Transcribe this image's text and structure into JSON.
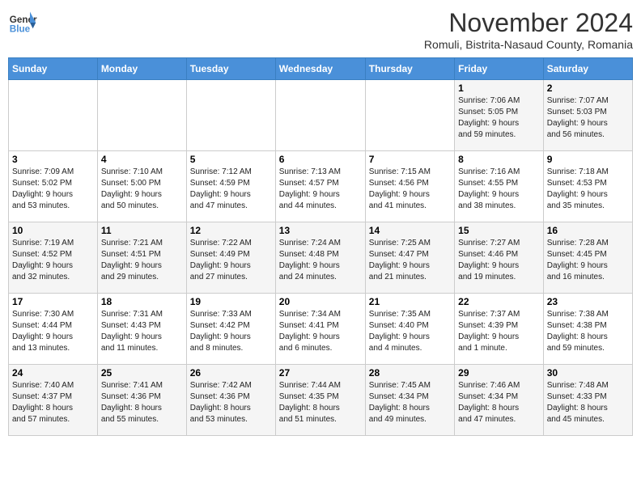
{
  "header": {
    "logo_line1": "General",
    "logo_line2": "Blue",
    "month": "November 2024",
    "location": "Romuli, Bistrita-Nasaud County, Romania"
  },
  "weekdays": [
    "Sunday",
    "Monday",
    "Tuesday",
    "Wednesday",
    "Thursday",
    "Friday",
    "Saturday"
  ],
  "weeks": [
    [
      {
        "num": "",
        "info": ""
      },
      {
        "num": "",
        "info": ""
      },
      {
        "num": "",
        "info": ""
      },
      {
        "num": "",
        "info": ""
      },
      {
        "num": "",
        "info": ""
      },
      {
        "num": "1",
        "info": "Sunrise: 7:06 AM\nSunset: 5:05 PM\nDaylight: 9 hours\nand 59 minutes."
      },
      {
        "num": "2",
        "info": "Sunrise: 7:07 AM\nSunset: 5:03 PM\nDaylight: 9 hours\nand 56 minutes."
      }
    ],
    [
      {
        "num": "3",
        "info": "Sunrise: 7:09 AM\nSunset: 5:02 PM\nDaylight: 9 hours\nand 53 minutes."
      },
      {
        "num": "4",
        "info": "Sunrise: 7:10 AM\nSunset: 5:00 PM\nDaylight: 9 hours\nand 50 minutes."
      },
      {
        "num": "5",
        "info": "Sunrise: 7:12 AM\nSunset: 4:59 PM\nDaylight: 9 hours\nand 47 minutes."
      },
      {
        "num": "6",
        "info": "Sunrise: 7:13 AM\nSunset: 4:57 PM\nDaylight: 9 hours\nand 44 minutes."
      },
      {
        "num": "7",
        "info": "Sunrise: 7:15 AM\nSunset: 4:56 PM\nDaylight: 9 hours\nand 41 minutes."
      },
      {
        "num": "8",
        "info": "Sunrise: 7:16 AM\nSunset: 4:55 PM\nDaylight: 9 hours\nand 38 minutes."
      },
      {
        "num": "9",
        "info": "Sunrise: 7:18 AM\nSunset: 4:53 PM\nDaylight: 9 hours\nand 35 minutes."
      }
    ],
    [
      {
        "num": "10",
        "info": "Sunrise: 7:19 AM\nSunset: 4:52 PM\nDaylight: 9 hours\nand 32 minutes."
      },
      {
        "num": "11",
        "info": "Sunrise: 7:21 AM\nSunset: 4:51 PM\nDaylight: 9 hours\nand 29 minutes."
      },
      {
        "num": "12",
        "info": "Sunrise: 7:22 AM\nSunset: 4:49 PM\nDaylight: 9 hours\nand 27 minutes."
      },
      {
        "num": "13",
        "info": "Sunrise: 7:24 AM\nSunset: 4:48 PM\nDaylight: 9 hours\nand 24 minutes."
      },
      {
        "num": "14",
        "info": "Sunrise: 7:25 AM\nSunset: 4:47 PM\nDaylight: 9 hours\nand 21 minutes."
      },
      {
        "num": "15",
        "info": "Sunrise: 7:27 AM\nSunset: 4:46 PM\nDaylight: 9 hours\nand 19 minutes."
      },
      {
        "num": "16",
        "info": "Sunrise: 7:28 AM\nSunset: 4:45 PM\nDaylight: 9 hours\nand 16 minutes."
      }
    ],
    [
      {
        "num": "17",
        "info": "Sunrise: 7:30 AM\nSunset: 4:44 PM\nDaylight: 9 hours\nand 13 minutes."
      },
      {
        "num": "18",
        "info": "Sunrise: 7:31 AM\nSunset: 4:43 PM\nDaylight: 9 hours\nand 11 minutes."
      },
      {
        "num": "19",
        "info": "Sunrise: 7:33 AM\nSunset: 4:42 PM\nDaylight: 9 hours\nand 8 minutes."
      },
      {
        "num": "20",
        "info": "Sunrise: 7:34 AM\nSunset: 4:41 PM\nDaylight: 9 hours\nand 6 minutes."
      },
      {
        "num": "21",
        "info": "Sunrise: 7:35 AM\nSunset: 4:40 PM\nDaylight: 9 hours\nand 4 minutes."
      },
      {
        "num": "22",
        "info": "Sunrise: 7:37 AM\nSunset: 4:39 PM\nDaylight: 9 hours\nand 1 minute."
      },
      {
        "num": "23",
        "info": "Sunrise: 7:38 AM\nSunset: 4:38 PM\nDaylight: 8 hours\nand 59 minutes."
      }
    ],
    [
      {
        "num": "24",
        "info": "Sunrise: 7:40 AM\nSunset: 4:37 PM\nDaylight: 8 hours\nand 57 minutes."
      },
      {
        "num": "25",
        "info": "Sunrise: 7:41 AM\nSunset: 4:36 PM\nDaylight: 8 hours\nand 55 minutes."
      },
      {
        "num": "26",
        "info": "Sunrise: 7:42 AM\nSunset: 4:36 PM\nDaylight: 8 hours\nand 53 minutes."
      },
      {
        "num": "27",
        "info": "Sunrise: 7:44 AM\nSunset: 4:35 PM\nDaylight: 8 hours\nand 51 minutes."
      },
      {
        "num": "28",
        "info": "Sunrise: 7:45 AM\nSunset: 4:34 PM\nDaylight: 8 hours\nand 49 minutes."
      },
      {
        "num": "29",
        "info": "Sunrise: 7:46 AM\nSunset: 4:34 PM\nDaylight: 8 hours\nand 47 minutes."
      },
      {
        "num": "30",
        "info": "Sunrise: 7:48 AM\nSunset: 4:33 PM\nDaylight: 8 hours\nand 45 minutes."
      }
    ]
  ]
}
